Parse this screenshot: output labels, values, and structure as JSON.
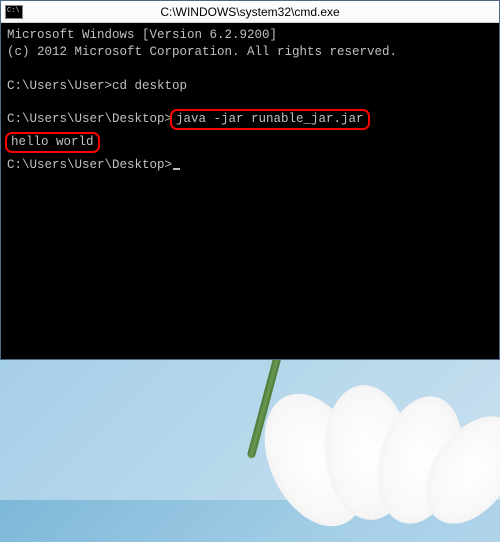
{
  "window": {
    "title": "C:\\WINDOWS\\system32\\cmd.exe"
  },
  "terminal": {
    "line1": "Microsoft Windows [Version 6.2.9200]",
    "line2": "(c) 2012 Microsoft Corporation. All rights reserved.",
    "prompt1": "C:\\Users\\User>",
    "cmd1": "cd desktop",
    "prompt2": "C:\\Users\\User\\Desktop>",
    "cmd2_highlighted": "java -jar runable_jar.jar",
    "output_highlighted": "hello world",
    "prompt3": "C:\\Users\\User\\Desktop>"
  }
}
